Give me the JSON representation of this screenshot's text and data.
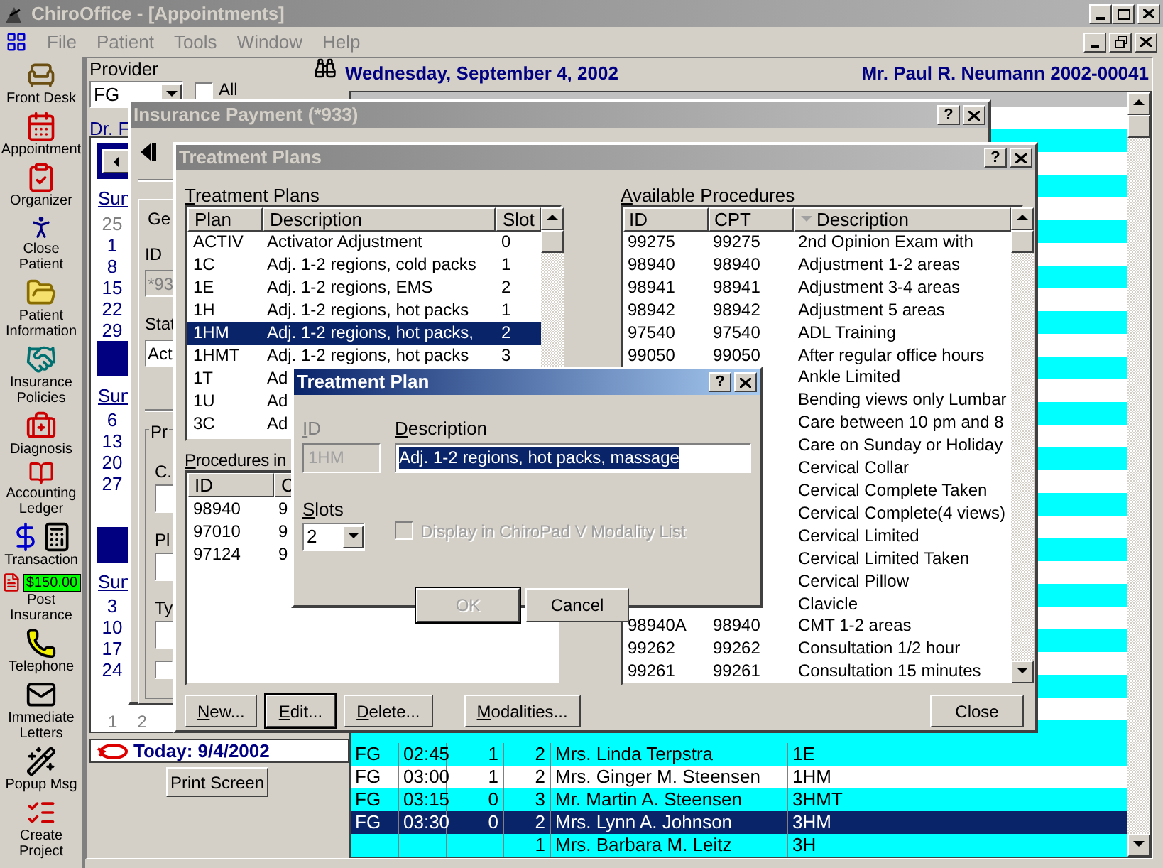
{
  "window": {
    "title": "ChiroOffice - [Appointments]"
  },
  "menu": [
    "File",
    "Patient",
    "Tools",
    "Window",
    "Help"
  ],
  "toolbar": [
    {
      "label": "Front Desk",
      "kind": "desk"
    },
    {
      "label": "Appointment",
      "kind": "calendar"
    },
    {
      "label": "Organizer",
      "kind": "organizer"
    },
    {
      "label": "Close Patient",
      "kind": "walker"
    },
    {
      "label": "Patient Information",
      "kind": "folder"
    },
    {
      "label": "Insurance Policies",
      "kind": "handshake"
    },
    {
      "label": "Diagnosis",
      "kind": "medkit"
    },
    {
      "label": "Accounting Ledger",
      "kind": "ledger"
    },
    {
      "label": "Transaction",
      "kind": "register"
    },
    {
      "label": "Post Insurance",
      "kind": "post",
      "badge": "$150.00"
    },
    {
      "label": "Telephone",
      "kind": "phone"
    },
    {
      "label": "Immediate Letters",
      "kind": "letter"
    },
    {
      "label": "Popup Msg",
      "kind": "hat"
    },
    {
      "label": "Create Project",
      "kind": "project"
    }
  ],
  "appointments": {
    "provider_label": "Provider",
    "provider": "FG",
    "all_label": "All",
    "all_checked": false,
    "date": "Wednesday, September 4, 2002",
    "patient": "Mr. Paul R. Neumann 2002-00041"
  },
  "calendar": {
    "doctor": "Dr. F",
    "months": [
      {
        "weekday": "Sun",
        "days": [
          {
            "text": "25",
            "other_month": true
          },
          {
            "text": "1",
            "other_month": false
          },
          {
            "text": "8",
            "other_month": false
          },
          {
            "text": "15",
            "other_month": false
          },
          {
            "text": "22",
            "other_month": false
          },
          {
            "text": "29",
            "other_month": false
          }
        ]
      },
      {
        "weekday": "Sun",
        "days": [
          {
            "text": "6",
            "other_month": false
          },
          {
            "text": "13",
            "other_month": false
          },
          {
            "text": "20",
            "other_month": false
          },
          {
            "text": "27",
            "other_month": false
          }
        ]
      },
      {
        "weekday": "Sun",
        "days": [
          {
            "text": "3",
            "other_month": false
          },
          {
            "text": "10",
            "other_month": false
          },
          {
            "text": "17",
            "other_month": false
          },
          {
            "text": "24",
            "other_month": false
          }
        ]
      }
    ],
    "footer_days": [
      "1",
      "2"
    ],
    "today": "Today: 9/4/2002"
  },
  "print_button": "Print Screen",
  "schedule": {
    "rows": [
      {
        "provider": "FG",
        "time": "02:45",
        "column_3": "1",
        "column_4": "2",
        "patient": "Mrs. Linda Terpstra",
        "plan": "1E",
        "selected": false
      },
      {
        "provider": "FG",
        "time": "03:00",
        "column_3": "1",
        "column_4": "2",
        "patient": "Mrs. Ginger M. Steensen",
        "plan": "1HM",
        "selected": false
      },
      {
        "provider": "FG",
        "time": "03:15",
        "column_3": "0",
        "column_4": "3",
        "patient": "Mr. Martin A. Steensen",
        "plan": "3HMT",
        "selected": false
      },
      {
        "provider": "FG",
        "time": "03:30",
        "column_3": "0",
        "column_4": "2",
        "patient": "Mrs. Lynn A. Johnson",
        "plan": "3HM",
        "selected": true
      },
      {
        "column_4": "1",
        "patient": "Mrs. Barbara M. Leitz",
        "plan": "3H",
        "selected": false
      }
    ]
  },
  "insurance_payment": {
    "title": "Insurance Payment (*933)",
    "help": "?",
    "active": false,
    "tab": "Ge",
    "id_label": "ID",
    "id_value": "*93",
    "status_label": "Stat",
    "status_value": "Act",
    "group_label": "Pr",
    "field_labels": [
      "C.",
      "Pl",
      "Ty"
    ],
    "checkbox_checked": false
  },
  "treatment_plans": {
    "title": "Treatment Plans",
    "help": "?",
    "active": false,
    "plans_label": "Treatment Plans",
    "plans_columns": [
      "Plan",
      "Description",
      "Slot"
    ],
    "plans": [
      {
        "plan": "ACTIV",
        "description": "Activator Adjustment",
        "slot": "0",
        "selected": false
      },
      {
        "plan": "1C",
        "description": "Adj. 1-2 regions, cold packs",
        "slot": "1",
        "selected": false
      },
      {
        "plan": "1E",
        "description": "Adj. 1-2 regions, EMS",
        "slot": "2",
        "selected": false
      },
      {
        "plan": "1H",
        "description": "Adj. 1-2 regions, hot packs",
        "slot": "1",
        "selected": false
      },
      {
        "plan": "1HM",
        "description": "Adj. 1-2 regions, hot packs,",
        "slot": "2",
        "selected": true
      },
      {
        "plan": "1HMT",
        "description": "Adj. 1-2 regions, hot packs",
        "slot": "3",
        "selected": false
      },
      {
        "plan": "1T",
        "description": "Ad",
        "selected": false
      },
      {
        "plan": "1U",
        "description": "Ad",
        "selected": false
      },
      {
        "plan": "3C",
        "description": "Ad",
        "selected": false
      }
    ],
    "procedures_label": "Procedures in",
    "procedures_columns": [
      "ID",
      "C"
    ],
    "procedures": [
      {
        "id": "98940",
        "column_2": "9"
      },
      {
        "id": "97010",
        "column_2": "9"
      },
      {
        "id": "97124",
        "column_2": "9"
      }
    ],
    "buttons": [
      {
        "label": "New...",
        "default": false
      },
      {
        "label": "Edit...",
        "default": true
      },
      {
        "label": "Delete...",
        "default": false
      },
      {
        "label": "Modalities...",
        "default": false
      }
    ],
    "close_button": "Close",
    "available_label": "Available Procedures",
    "available_columns": [
      "ID",
      "CPT",
      "Description"
    ],
    "available": [
      {
        "id": "99275",
        "cpt": "99275",
        "description": "2nd Opinion Exam with"
      },
      {
        "id": "98940",
        "cpt": "98940",
        "description": "Adjustment 1-2 areas"
      },
      {
        "id": "98941",
        "cpt": "98941",
        "description": "Adjustment 3-4 areas"
      },
      {
        "id": "98942",
        "cpt": "98942",
        "description": "Adjustment 5 areas"
      },
      {
        "id": "97540",
        "cpt": "97540",
        "description": "ADL Training"
      },
      {
        "id": "99050",
        "cpt": "99050",
        "description": "After regular office hours"
      },
      {
        "description": "Ankle Limited"
      },
      {
        "description": "Bending views only Lumbar"
      },
      {
        "description": "Care between 10 pm and 8"
      },
      {
        "description": "Care on Sunday or Holiday"
      },
      {
        "description": "Cervical Collar"
      },
      {
        "description": "Cervical Complete Taken"
      },
      {
        "description": "Cervical Complete(4 views)"
      },
      {
        "description": "Cervical Limited"
      },
      {
        "description": "Cervical Limited Taken"
      },
      {
        "description": "Cervical Pillow"
      },
      {
        "description": "Clavicle"
      },
      {
        "id": "98940A",
        "cpt": "98940",
        "description": "CMT 1-2 areas"
      },
      {
        "id": "99262",
        "cpt": "99262",
        "description": "Consultation 1/2 hour"
      },
      {
        "id": "99261",
        "cpt": "99261",
        "description": "Consultation 15 minutes"
      }
    ]
  },
  "treatment_plan_dialog": {
    "title": "Treatment Plan",
    "help": "?",
    "active": true,
    "id_label": "ID",
    "id_value": "1HM",
    "id_disabled": true,
    "description_label": "Description",
    "description_value": "Adj. 1-2 regions, hot packs, massage",
    "slots_label": "Slots",
    "slots_value": "2",
    "modality_checkbox": {
      "label": "Display in ChiroPad V Modality List",
      "checked": false,
      "disabled": true
    },
    "ok": {
      "label": "OK",
      "disabled": true
    },
    "cancel": "Cancel"
  }
}
